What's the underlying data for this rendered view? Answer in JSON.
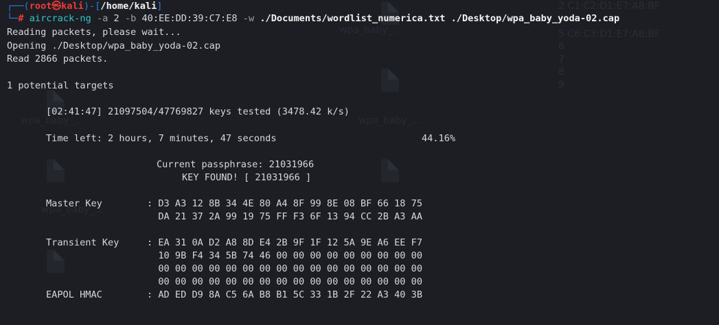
{
  "background_files": {
    "label_1": "wpa_baby_...",
    "label_2": "wpa_baby_...",
    "label_3": "wpa_baby_...",
    "label_4": "wpa_baby_...",
    "side_list": [
      "2 C1:C2:D1:E7:A8:BF",
      "5 C6:C3:D1:E7:A8:BF",
      "6",
      "7",
      "8",
      "9"
    ]
  },
  "prompt": {
    "user": "root",
    "separator": "㉿",
    "host": "kali",
    "cwd": "/home/kali",
    "symbol": "#"
  },
  "command": {
    "program": "aircrack-ng",
    "flag_a": "-a",
    "val_a": "2",
    "flag_b": "-b",
    "val_b": "40:EE:DD:39:C7:E8",
    "flag_w": "-w",
    "wordlist": "./Documents/wordlist_numerica.txt",
    "capfile": "./Desktop/wpa_baby_yoda-02.cap"
  },
  "output": {
    "reading": "Reading packets, please wait...",
    "opening": "Opening ./Desktop/wpa_baby_yoda-02.cap",
    "read": "Read 2866 packets.",
    "targets": "1 potential targets",
    "progress": "[02:41:47] 21097504/47769827 keys tested (3478.42 k/s)",
    "time_left": "Time left: 2 hours, 7 minutes, 47 seconds",
    "percent": "44.16%",
    "current_passphrase": "Current passphrase: 21031966",
    "key_found": "KEY FOUND! [ 21031966 ]",
    "master_key_label": "Master Key",
    "master_key_1": ": D3 A3 12 8B 34 4E 80 A4 8F 99 8E 08 BF 66 18 75",
    "master_key_2": "  DA 21 37 2A 99 19 75 FF F3 6F 13 94 CC 2B A3 AA",
    "transient_key_label": "Transient Key",
    "transient_key_1": ": EA 31 0A D2 A8 8D E4 2B 9F 1F 12 5A 9E A6 EE F7",
    "transient_key_2": "  10 9B F4 34 5B 74 46 00 00 00 00 00 00 00 00 00",
    "transient_key_3": "  00 00 00 00 00 00 00 00 00 00 00 00 00 00 00 00",
    "transient_key_4": "  00 00 00 00 00 00 00 00 00 00 00 00 00 00 00 00",
    "eapol_label": "EAPOL HMAC",
    "eapol_value": ": AD ED D9 8A C5 6A B8 B1 5C 33 1B 2F 22 A3 40 3B"
  }
}
